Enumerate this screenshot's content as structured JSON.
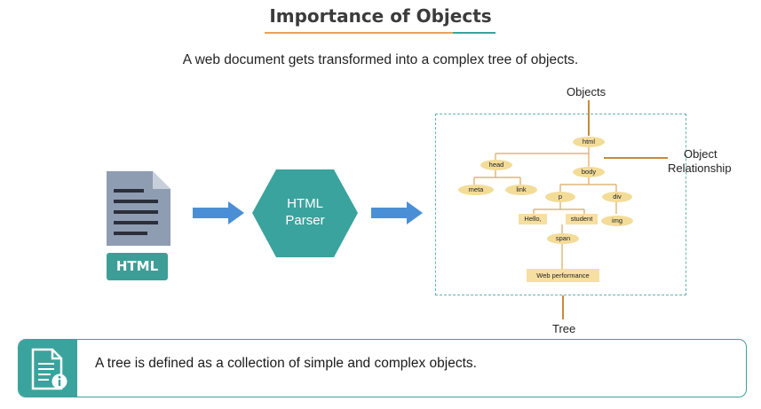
{
  "title": "Importance of Objects",
  "subtitle": "A web document gets transformed into a complex tree of objects.",
  "doc_badge": "HTML",
  "parser_label_line1": "HTML",
  "parser_label_line2": "Parser",
  "labels": {
    "objects": "Objects",
    "relationship_line1": "Object",
    "relationship_line2": "Relationship",
    "tree": "Tree"
  },
  "tree_nodes": {
    "html": "html",
    "head": "head",
    "body": "body",
    "meta": "meta",
    "link": "link",
    "p": "p",
    "div": "div",
    "hello": "Hello,",
    "student": "student",
    "img": "img",
    "span": "span",
    "webperf": "Web performance"
  },
  "footer_text": "A tree is defined as a collection of simple and complex objects.",
  "colors": {
    "teal": "#3aa39d",
    "arrow_blue": "#4a8fd6",
    "node_fill": "#f3dc98",
    "line_brown": "#c88a3a",
    "doc_gray": "#8f9db3"
  }
}
